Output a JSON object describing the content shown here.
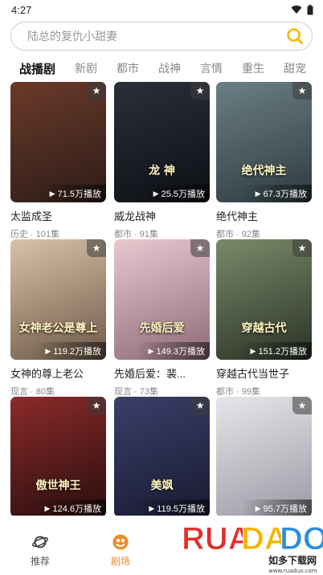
{
  "status": {
    "time": "4:27"
  },
  "search": {
    "placeholder": "陆总的复仇小甜妻"
  },
  "tabs": [
    {
      "label": "战播剧",
      "active": true
    },
    {
      "label": "新剧",
      "active": false
    },
    {
      "label": "都市",
      "active": false
    },
    {
      "label": "战神",
      "active": false
    },
    {
      "label": "言情",
      "active": false
    },
    {
      "label": "重生",
      "active": false
    },
    {
      "label": "甜宠",
      "active": false
    }
  ],
  "dramas": [
    {
      "title": "太监成圣",
      "meta": "历史 · 101集",
      "plays": "71.5万播放",
      "poster_text": "",
      "colors": [
        "#6b3a2a",
        "#2d1c18"
      ]
    },
    {
      "title": "威龙战神",
      "meta": "都市 · 91集",
      "plays": "25.5万播放",
      "poster_text": "龙 神",
      "colors": [
        "#2b2f3a",
        "#0d0f14"
      ]
    },
    {
      "title": "绝代神主",
      "meta": "都市 · 92集",
      "plays": "67.3万播放",
      "poster_text": "绝代神主",
      "colors": [
        "#6b7f86",
        "#2e3b3f"
      ]
    },
    {
      "title": "女神的尊上老公",
      "meta": "现言 · 80集",
      "plays": "119.2万播放",
      "poster_text": "女神老公是尊上",
      "colors": [
        "#d8c2a8",
        "#6e5a48"
      ]
    },
    {
      "title": "先婚后爱：裴...",
      "meta": "现言 · 73集",
      "plays": "149.3万播放",
      "poster_text": "先婚后爱",
      "colors": [
        "#e8c9d0",
        "#8e6a78"
      ]
    },
    {
      "title": "穿越古代当世子",
      "meta": "都市 · 99集",
      "plays": "151.2万播放",
      "poster_text": "穿越古代",
      "colors": [
        "#7a8a6a",
        "#2b3326"
      ]
    },
    {
      "title": "",
      "meta": "",
      "plays": "124.6万播放",
      "poster_text": "傲世神王",
      "colors": [
        "#8a2a2a",
        "#2a0e0e"
      ]
    },
    {
      "title": "",
      "meta": "",
      "plays": "119.5万播放",
      "poster_text": "美飒",
      "colors": [
        "#3a3f6a",
        "#181a30"
      ]
    },
    {
      "title": "",
      "meta": "",
      "plays": "95.7万播放",
      "poster_text": "",
      "colors": [
        "#e6e6ea",
        "#9a9aa4"
      ]
    }
  ],
  "nav": [
    {
      "label": "推荐",
      "icon": "planet-icon",
      "active": false
    },
    {
      "label": "剧场",
      "icon": "theater-icon",
      "active": true
    }
  ],
  "watermark": {
    "text": "RUADADO",
    "sub": "如多下载网",
    "url": "www.ruaduo.com"
  },
  "accent": "#f08a24",
  "search_icon_color": "#f5b800"
}
